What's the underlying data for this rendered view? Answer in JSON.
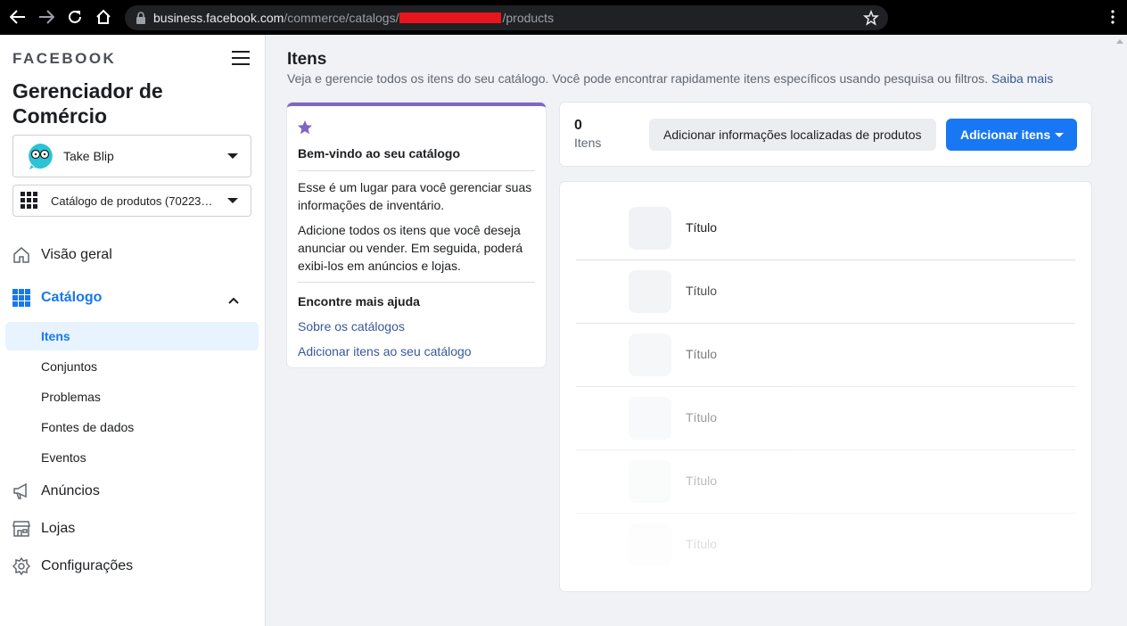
{
  "browser": {
    "url_host": "business.facebook.com",
    "url_path_before": "/commerce/catalogs/",
    "url_path_after": "/products"
  },
  "sidebar": {
    "logo": "FACEBOOK",
    "title": "Gerenciador de Comércio",
    "business_name": "Take Blip",
    "catalog_name": "Catálogo de produtos (70223…",
    "nav": {
      "overview": "Visão geral",
      "catalog": "Catálogo",
      "ads": "Anúncios",
      "shops": "Lojas",
      "settings": "Configurações"
    },
    "catalog_items": [
      "Itens",
      "Conjuntos",
      "Problemas",
      "Fontes de dados",
      "Eventos"
    ]
  },
  "main": {
    "title": "Itens",
    "description": "Veja e gerencie todos os itens do seu catálogo. Você pode encontrar rapidamente itens específicos usando pesquisa ou filtros.",
    "learn_more": "Saiba mais",
    "welcome": {
      "title": "Bem-vindo ao seu catálogo",
      "p1": "Esse é um lugar para você gerenciar suas informações de inventário.",
      "p2": "Adicione todos os itens que você deseja anunciar ou vender. Em seguida, poderá exibi-los em anúncios e lojas.",
      "help_title": "Encontre mais ajuda",
      "link1": "Sobre os catálogos",
      "link2": "Adicionar itens ao seu catálogo"
    },
    "count": "0",
    "count_label": "Itens",
    "btn_localized": "Adicionar informações localizadas de produtos",
    "btn_add": "Adicionar itens",
    "placeholder_rows": [
      "Título",
      "Título",
      "Título",
      "Título",
      "Título",
      "Título"
    ]
  },
  "colors": {
    "accent": "#1877f2",
    "welcome_bar": "#7f66c4",
    "link": "#385898"
  }
}
